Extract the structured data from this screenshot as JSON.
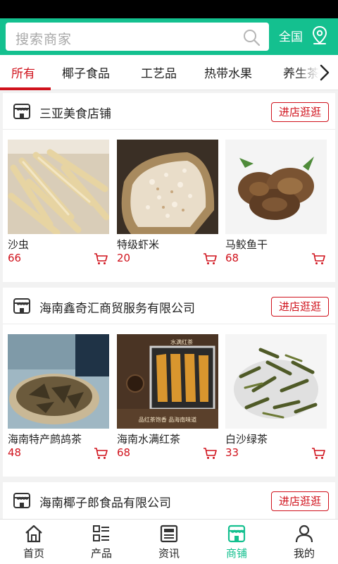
{
  "search": {
    "placeholder": "搜索商家"
  },
  "header": {
    "region": "全国"
  },
  "tabs": [
    {
      "label": "所有",
      "active": true
    },
    {
      "label": "椰子食品"
    },
    {
      "label": "工艺品"
    },
    {
      "label": "热带水果"
    },
    {
      "label": "养生茶"
    }
  ],
  "shops": [
    {
      "name": "三亚美食店铺",
      "enter_label": "进店逛逛",
      "products": [
        {
          "name": "沙虫",
          "price": "66"
        },
        {
          "name": "特级虾米",
          "price": "20"
        },
        {
          "name": "马鲛鱼干",
          "price": "68"
        }
      ]
    },
    {
      "name": "海南鑫奇汇商贸服务有限公司",
      "enter_label": "进店逛逛",
      "products": [
        {
          "name": "海南特产鹧鸪茶",
          "price": "48"
        },
        {
          "name": "海南水满红茶",
          "price": "68",
          "box_text": "水满红茶",
          "caption": "品红茶饱香  品海南味道"
        },
        {
          "name": "白沙绿茶",
          "price": "33"
        }
      ]
    },
    {
      "name": "海南椰子郎食品有限公司",
      "enter_label": "进店逛逛"
    }
  ],
  "bottom_nav": [
    {
      "label": "首页",
      "icon": "home-icon"
    },
    {
      "label": "产品",
      "icon": "list-icon"
    },
    {
      "label": "资讯",
      "icon": "news-icon"
    },
    {
      "label": "商铺",
      "icon": "store-icon",
      "active": true
    },
    {
      "label": "我的",
      "icon": "user-icon"
    }
  ],
  "colors": {
    "brand": "#14c08f",
    "accent": "#d0121c",
    "price": "#d0121c"
  }
}
